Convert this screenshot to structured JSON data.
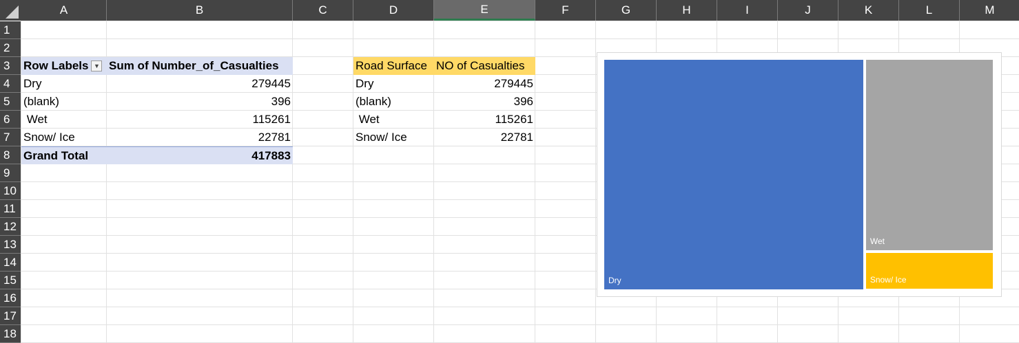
{
  "columns": [
    "A",
    "B",
    "C",
    "D",
    "E",
    "F",
    "G",
    "H",
    "I",
    "J",
    "K",
    "L",
    "M"
  ],
  "rows": [
    "1",
    "2",
    "3",
    "4",
    "5",
    "6",
    "7",
    "8",
    "9",
    "10",
    "11",
    "12",
    "13",
    "14",
    "15",
    "16",
    "17",
    "18"
  ],
  "pivot": {
    "header_row_labels": "Row Labels",
    "header_sum": "Sum of Number_of_Casualties",
    "rows": [
      {
        "label": "Dry",
        "value": "279445"
      },
      {
        "label": "(blank)",
        "value": "396"
      },
      {
        "label": " Wet",
        "value": "115261"
      },
      {
        "label": "Snow/ Ice",
        "value": "22781"
      }
    ],
    "total_label": "Grand Total",
    "total_value": "417883"
  },
  "copy_table": {
    "header_road": "Road Surface",
    "header_casualties": "NO of Casualties",
    "rows": [
      {
        "label": "Dry",
        "value": "279445"
      },
      {
        "label": "(blank)",
        "value": "396"
      },
      {
        "label": " Wet",
        "value": "115261"
      },
      {
        "label": "Snow/ Ice",
        "value": "22781"
      }
    ]
  },
  "chart_data": {
    "type": "treemap",
    "categories": [
      "Dry",
      "Wet",
      "Snow/ Ice",
      "(blank)"
    ],
    "values": [
      279445,
      115261,
      22781,
      396
    ],
    "labels": [
      "Dry",
      "Wet",
      "Snow/ Ice"
    ],
    "colors": [
      "#4472c4",
      "#a5a5a5",
      "#ffc000",
      "#5b9bd5"
    ]
  }
}
